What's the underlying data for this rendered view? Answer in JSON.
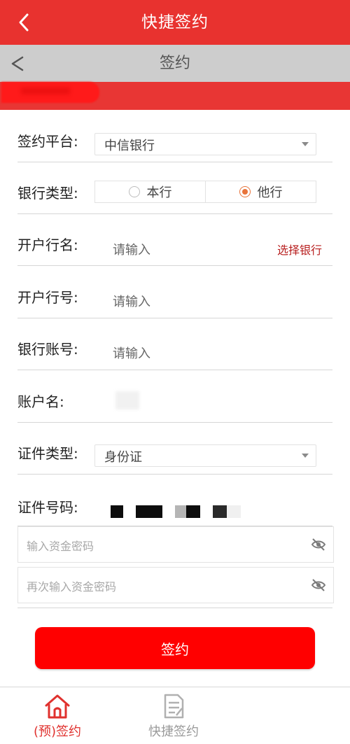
{
  "header": {
    "title": "快捷签约"
  },
  "subheader": {
    "title": "签约"
  },
  "form": {
    "platform": {
      "label": "签约平台:",
      "value": "中信银行"
    },
    "bank_type": {
      "label": "银行类型:",
      "options": [
        "本行",
        "他行"
      ],
      "selected": "他行"
    },
    "branch_name": {
      "label": "开户行名:",
      "placeholder": "请输入",
      "action": "选择银行"
    },
    "branch_no": {
      "label": "开户行号:",
      "placeholder": "请输入"
    },
    "account_no": {
      "label": "银行账号:",
      "placeholder": "请输入"
    },
    "account_name": {
      "label": "账户名:"
    },
    "id_type": {
      "label": "证件类型:",
      "value": "身份证"
    },
    "id_no": {
      "label": "证件号码:"
    },
    "password": {
      "placeholder": "输入资金密码"
    },
    "password_confirm": {
      "placeholder": "再次输入资金密码"
    }
  },
  "submit_label": "签约",
  "tabs": [
    {
      "label": "(预)签约",
      "icon": "home-icon",
      "active": true
    },
    {
      "label": "快捷签约",
      "icon": "document-icon",
      "active": false
    }
  ],
  "colors": {
    "primary": "#e8322f",
    "button": "#ff0000",
    "accent_radio": "#e8733a",
    "link": "#b81f1f"
  }
}
